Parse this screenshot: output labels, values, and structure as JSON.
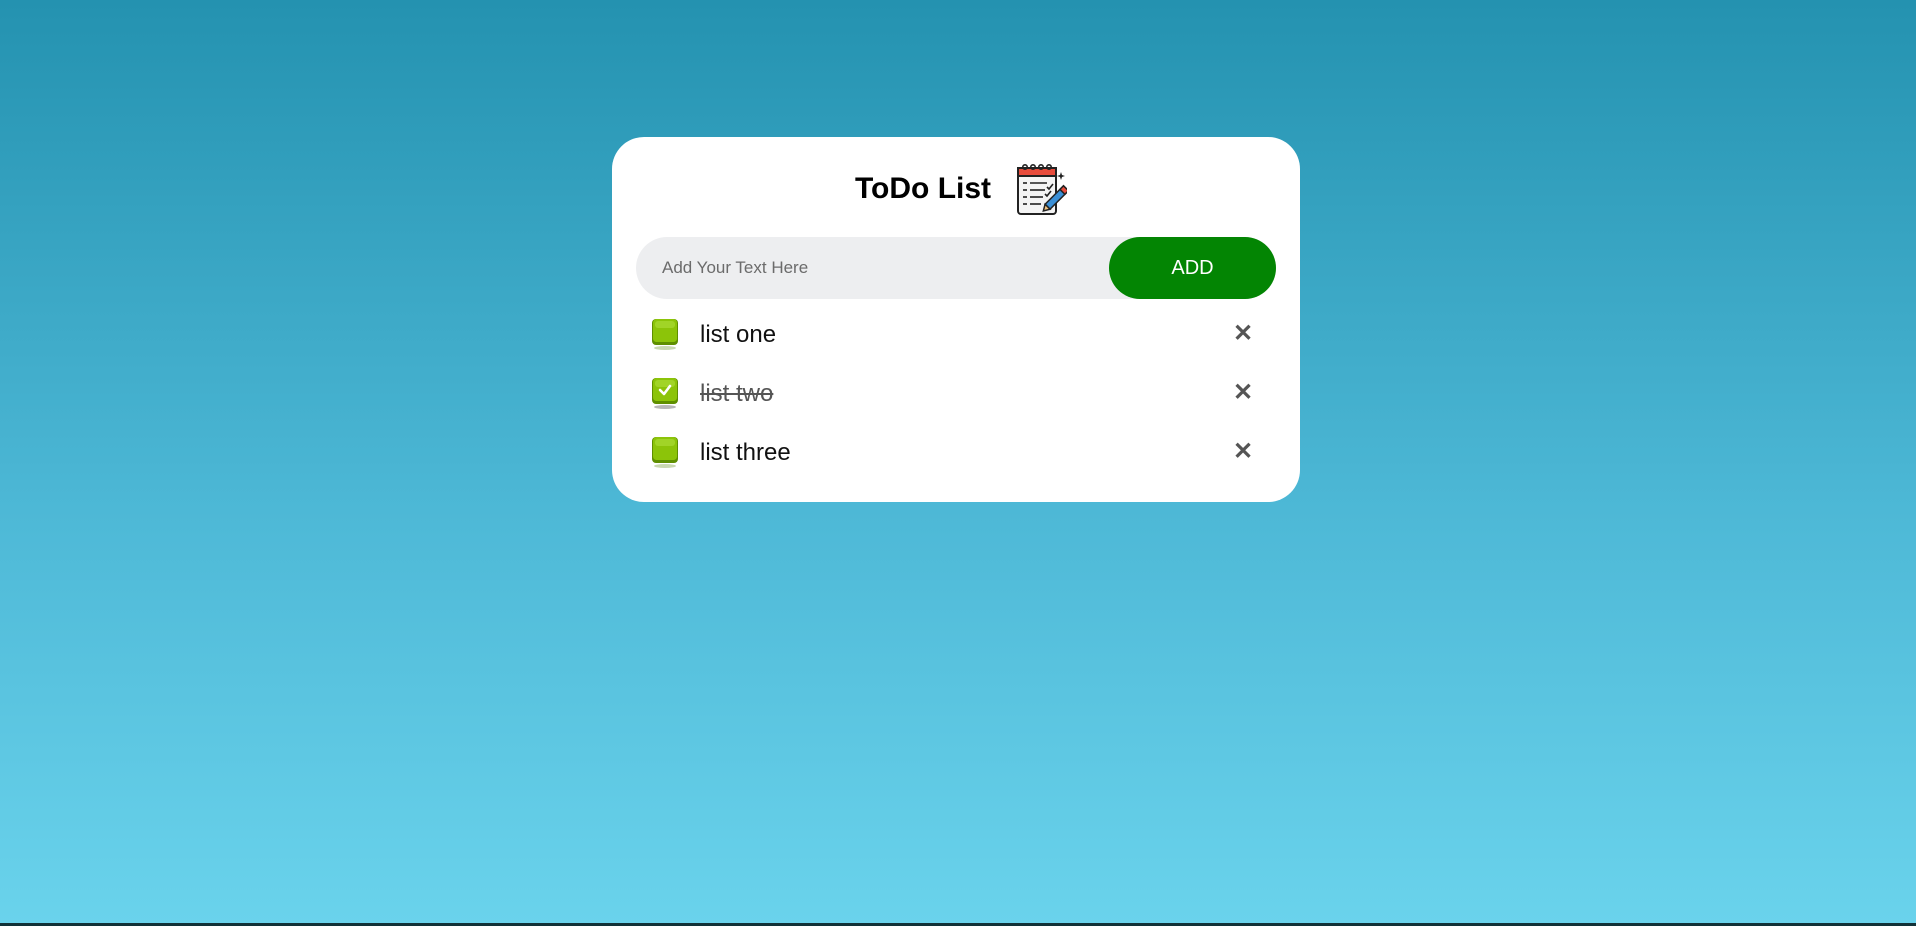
{
  "app": {
    "title": "ToDo List",
    "title_icon": "notepad-checklist-icon"
  },
  "input": {
    "placeholder": "Add Your Text Here",
    "value": ""
  },
  "add_button": {
    "label": "ADD"
  },
  "todos": [
    {
      "label": "list one",
      "checked": false
    },
    {
      "label": "list two",
      "checked": true
    },
    {
      "label": "list three",
      "checked": false
    }
  ],
  "delete_glyph": "✕",
  "colors": {
    "add_button": "#038503",
    "checkbox": "#8cc409",
    "background_top": "#2492b0",
    "background_bottom": "#6ad3ec"
  }
}
